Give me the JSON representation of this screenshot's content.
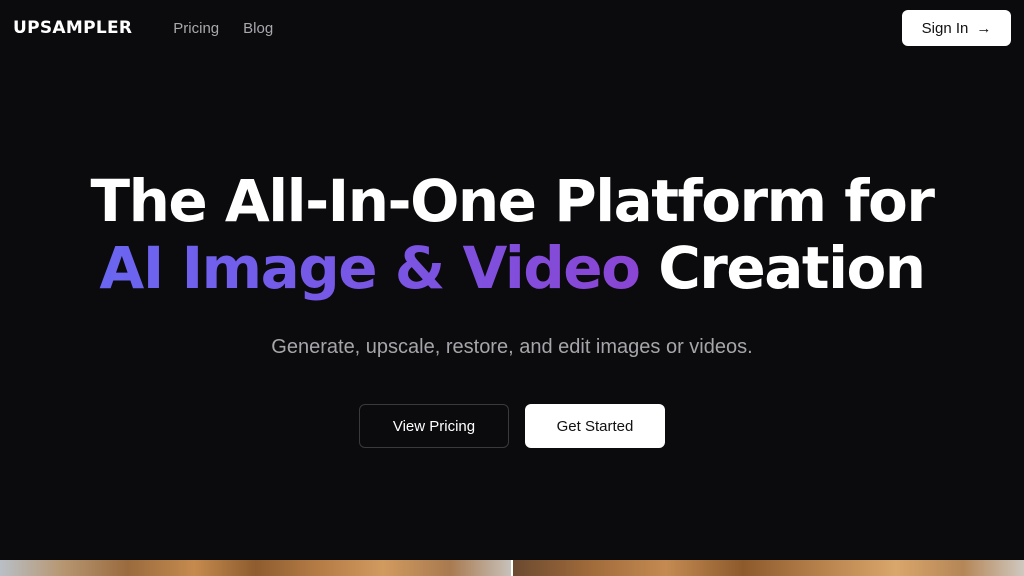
{
  "header": {
    "logo": "UPSAMPLER",
    "nav": [
      {
        "label": "Pricing"
      },
      {
        "label": "Blog"
      }
    ],
    "signin_label": "Sign In",
    "signin_icon": "arrow-right-icon"
  },
  "hero": {
    "title_line1": "The All-In-One Platform for",
    "title_line2_gradient": "AI Image & Video",
    "title_line2_rest": "Creation",
    "subtitle": "Generate, upscale, restore, and edit images or videos.",
    "view_pricing_label": "View Pricing",
    "get_started_label": "Get Started"
  },
  "colors": {
    "background": "#0b0a0c",
    "gradient_start": "#6a66f1",
    "gradient_end": "#8a45d3",
    "muted_text": "#a6a5aa"
  }
}
